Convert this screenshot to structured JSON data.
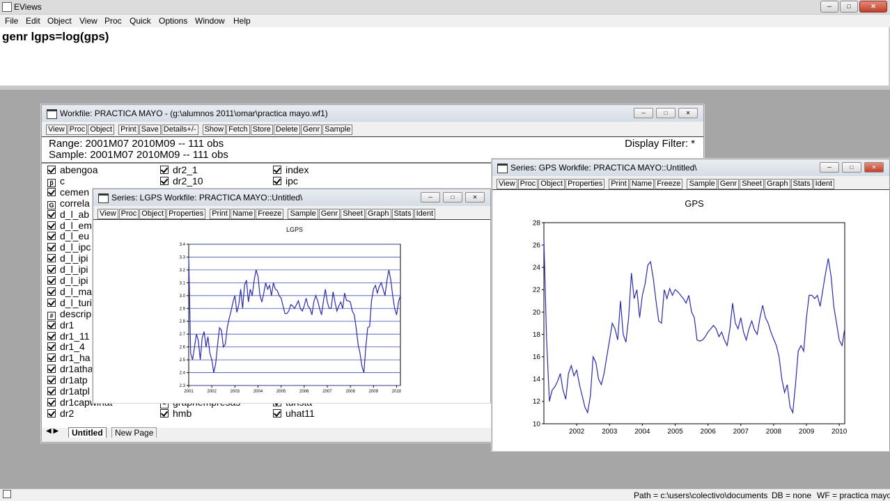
{
  "app": {
    "title": "EViews"
  },
  "menu": [
    "File",
    "Edit",
    "Object",
    "View",
    "Proc",
    "Quick",
    "Options",
    "Window",
    "Help"
  ],
  "command": {
    "text": "genr lgps=log(gps)"
  },
  "workfile": {
    "title": "Workfile: PRACTICA MAYO - (g:\\alumnos 2011\\omar\\practica mayo.wf1)",
    "toolbar": [
      "View",
      "Proc",
      "Object",
      "Print",
      "Save",
      "Details+/-",
      "Show",
      "Fetch",
      "Store",
      "Delete",
      "Genr",
      "Sample"
    ],
    "range": "Range:  2001M07 2010M09  --  111 obs",
    "sample": "Sample: 2001M07 2010M09  --  111 obs",
    "filter": "Display Filter: *",
    "col1": [
      {
        "icon": "series",
        "name": "abengoa"
      },
      {
        "icon": "coef",
        "name": "c"
      },
      {
        "icon": "series",
        "name": "cemen"
      },
      {
        "icon": "group",
        "name": "correla"
      },
      {
        "icon": "series",
        "name": "d_l_ab"
      },
      {
        "icon": "series",
        "name": "d_l_em"
      },
      {
        "icon": "series",
        "name": "d_l_eu"
      },
      {
        "icon": "series",
        "name": "d_l_ipc"
      },
      {
        "icon": "series",
        "name": "d_l_ipi"
      },
      {
        "icon": "series",
        "name": "d_l_ipi"
      },
      {
        "icon": "series",
        "name": "d_l_ipi"
      },
      {
        "icon": "series",
        "name": "d_l_ma"
      },
      {
        "icon": "series",
        "name": "d_l_turi"
      },
      {
        "icon": "table",
        "name": "descrip"
      },
      {
        "icon": "series",
        "name": "dr1"
      },
      {
        "icon": "series",
        "name": "dr1_11"
      },
      {
        "icon": "series",
        "name": "dr1_4"
      },
      {
        "icon": "series",
        "name": "dr1_ha"
      },
      {
        "icon": "series",
        "name": "dr1atha"
      },
      {
        "icon": "series",
        "name": "dr1atp"
      },
      {
        "icon": "series",
        "name": "dr1atpl"
      },
      {
        "icon": "series",
        "name": "dr1capwinat"
      },
      {
        "icon": "series",
        "name": "dr2"
      }
    ],
    "col2": [
      {
        "icon": "series",
        "name": "dr2_1"
      },
      {
        "icon": "series",
        "name": "dr2_10"
      },
      {
        "icon": "graph",
        "name": "graphempresas"
      },
      {
        "icon": "series",
        "name": "hmb"
      }
    ],
    "col3": [
      {
        "icon": "series",
        "name": "index"
      },
      {
        "icon": "series",
        "name": "ipc"
      },
      {
        "icon": "series",
        "name": "turista"
      },
      {
        "icon": "series",
        "name": "uhat11"
      }
    ],
    "tabs": [
      "Untitled",
      "New Page"
    ]
  },
  "lgps_window": {
    "title": "Series: LGPS   Workfile: PRACTICA MAYO::Untitled\\",
    "toolbar": [
      "View",
      "Proc",
      "Object",
      "Properties",
      "Print",
      "Name",
      "Freeze",
      "Sample",
      "Genr",
      "Sheet",
      "Graph",
      "Stats",
      "Ident"
    ]
  },
  "gps_window": {
    "title": "Series: GPS   Workfile: PRACTICA MAYO::Untitled\\",
    "toolbar": [
      "View",
      "Proc",
      "Object",
      "Properties",
      "Print",
      "Name",
      "Freeze",
      "Sample",
      "Genr",
      "Sheet",
      "Graph",
      "Stats",
      "Ident"
    ]
  },
  "chart_data": [
    {
      "type": "line",
      "title": "LGPS",
      "x_ticks": [
        "2001",
        "2002",
        "2003",
        "2004",
        "2005",
        "2006",
        "2007",
        "2008",
        "2009",
        "2010"
      ],
      "ylim": [
        2.3,
        3.4
      ],
      "y_ticks": [
        "2.3",
        "2.4",
        "2.5",
        "2.6",
        "2.7",
        "2.8",
        "2.9",
        "3.0",
        "3.1",
        "3.2",
        "3.3",
        "3.4"
      ],
      "grid": "horizontal",
      "line_color": "#2828b4",
      "series": [
        {
          "x_start": 2001.5,
          "x_step": 0.08333,
          "values": [
            3.3,
            2.55,
            2.5,
            2.6,
            2.7,
            2.65,
            2.5,
            2.67,
            2.72,
            2.6,
            2.68,
            2.55,
            2.5,
            2.4,
            2.47,
            2.62,
            2.75,
            2.73,
            2.6,
            2.62,
            2.75,
            2.82,
            2.88,
            2.95,
            3.0,
            2.87,
            2.93,
            3.05,
            2.9,
            3.08,
            3.12,
            2.95,
            3.05,
            3.0,
            3.12,
            3.2,
            3.15,
            3.0,
            2.95,
            3.02,
            3.1,
            3.05,
            3.08,
            3.0,
            3.1,
            3.05,
            3.04,
            3.0,
            2.98,
            2.92,
            2.86,
            2.86,
            2.88,
            2.93,
            2.92,
            2.9,
            2.93,
            2.96,
            2.9,
            2.88,
            2.92,
            2.98,
            2.92,
            2.9,
            2.85,
            2.95,
            3.0,
            2.96,
            2.9,
            2.85,
            2.96,
            3.05,
            2.95,
            2.9,
            2.9,
            3.03,
            2.95,
            2.88,
            2.92,
            2.95,
            2.9,
            3.02,
            2.96,
            2.96,
            2.95,
            2.88,
            2.85,
            2.75,
            2.62,
            2.55,
            2.45,
            2.4,
            2.6,
            2.75,
            2.76,
            2.96,
            3.05,
            3.08,
            3.02,
            3.07,
            3.1,
            3.05,
            3.0,
            3.12,
            3.2,
            3.12,
            3.0,
            2.9,
            2.85,
            2.95,
            3.0
          ]
        }
      ]
    },
    {
      "type": "line",
      "title": "GPS",
      "x_ticks": [
        "2002",
        "2003",
        "2004",
        "2005",
        "2006",
        "2007",
        "2008",
        "2009",
        "2010"
      ],
      "ylim": [
        10,
        28
      ],
      "y_ticks": [
        "10",
        "12",
        "14",
        "16",
        "18",
        "20",
        "22",
        "24",
        "26",
        "28"
      ],
      "grid": "none",
      "line_color": "#2828b4",
      "series": [
        {
          "x_start": 2001.5,
          "x_step": 0.08333,
          "values": [
            26.5,
            17.5,
            12,
            13,
            13.3,
            13.8,
            14.5,
            13,
            12.2,
            14.5,
            15.2,
            14.3,
            14.8,
            13.5,
            12.5,
            11.5,
            11.0,
            12.5,
            16,
            15.5,
            14,
            13.5,
            14.5,
            16,
            17.5,
            19,
            18.5,
            17.5,
            21,
            18,
            17.3,
            19.5,
            23.5,
            21.2,
            22,
            19.5,
            21.5,
            22.5,
            24.2,
            24.5,
            23,
            21,
            19.2,
            19,
            22,
            21.2,
            22.1,
            21.5,
            22,
            21.8,
            21.5,
            21.2,
            20.8,
            21.5,
            20,
            19.5,
            17.5,
            17.4,
            17.5,
            17.8,
            18.2,
            18.5,
            18.8,
            18.5,
            17.8,
            18.2,
            17.5,
            17.0,
            18.5,
            20.8,
            19.0,
            18.5,
            19.5,
            18.2,
            17.5,
            18.5,
            19.2,
            18.4,
            18.0,
            19.5,
            20.6,
            19.5,
            19.0,
            18.2,
            17.6,
            17.0,
            16.0,
            14.0,
            12.8,
            13.5,
            11.5,
            11.0,
            13.5,
            16.5,
            17.0,
            16.5,
            19.5,
            21.5,
            21.5,
            21.2,
            21.5,
            20.5,
            22.0,
            23.5,
            24.8,
            23.2,
            20.5,
            19.0,
            17.5,
            17.0,
            18.5
          ]
        }
      ]
    }
  ],
  "statusbar": {
    "path": "Path = c:\\users\\colectivo\\documents",
    "db": "DB = none",
    "wf": "WF = practica mayo"
  }
}
